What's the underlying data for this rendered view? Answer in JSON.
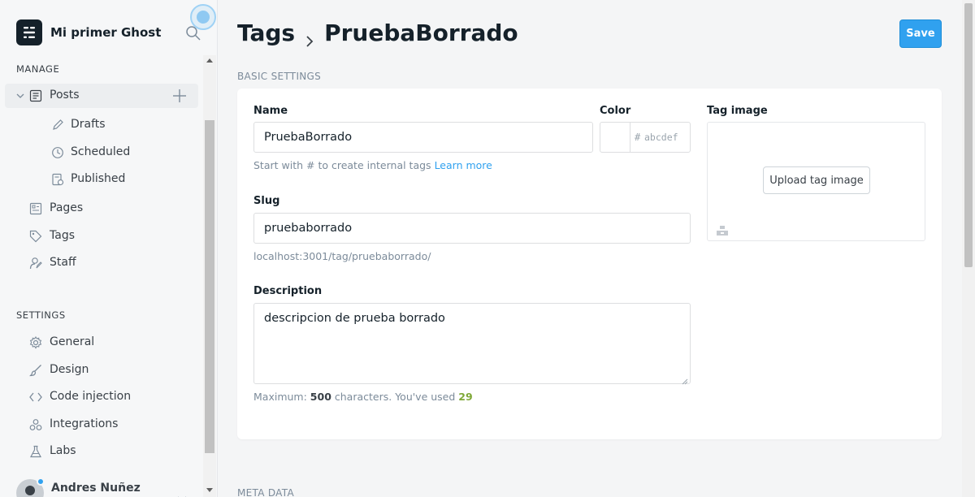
{
  "brand": {
    "name": "Mi primer Ghost",
    "logo_icon": "ghost-logo-icon"
  },
  "sidebar": {
    "manage_title": "MANAGE",
    "settings_title": "SETTINGS",
    "posts": {
      "label": "Posts",
      "icon": "posts-icon"
    },
    "posts_sub": [
      {
        "label": "Drafts",
        "icon": "pencil-icon"
      },
      {
        "label": "Scheduled",
        "icon": "clock-icon"
      },
      {
        "label": "Published",
        "icon": "published-icon"
      }
    ],
    "manage_items": [
      {
        "label": "Pages",
        "icon": "pages-icon"
      },
      {
        "label": "Tags",
        "icon": "tag-icon"
      },
      {
        "label": "Staff",
        "icon": "staff-icon"
      }
    ],
    "settings_items": [
      {
        "label": "General",
        "icon": "gear-icon"
      },
      {
        "label": "Design",
        "icon": "brush-icon"
      },
      {
        "label": "Code injection",
        "icon": "code-icon"
      },
      {
        "label": "Integrations",
        "icon": "integrations-icon"
      },
      {
        "label": "Labs",
        "icon": "flask-icon"
      }
    ],
    "user": {
      "name": "Andres Nuñez"
    }
  },
  "header": {
    "breadcrumb_root": "Tags",
    "breadcrumb_current": "PruebaBorrado",
    "save_label": "Save"
  },
  "basic": {
    "section_title": "BASIC SETTINGS",
    "name_label": "Name",
    "name_value": "PruebaBorrado",
    "name_help": "Start with # to create internal tags",
    "learn_more": "Learn more",
    "color_label": "Color",
    "color_hash": "#",
    "color_placeholder": "abcdef",
    "slug_label": "Slug",
    "slug_value": "pruebaborrado",
    "slug_url": "localhost:3001/tag/pruebaborrado/",
    "description_label": "Description",
    "description_value": "descripcion de prueba borrado",
    "max_prefix": "Maximum:",
    "max_count": "500",
    "max_middle": "characters. You've used",
    "used_count": "29",
    "tag_image_label": "Tag image",
    "upload_label": "Upload tag image"
  },
  "meta": {
    "section_title": "META DATA"
  },
  "colors": {
    "accent": "#30a1ef",
    "success": "#7fa838",
    "text": "#15212a"
  }
}
